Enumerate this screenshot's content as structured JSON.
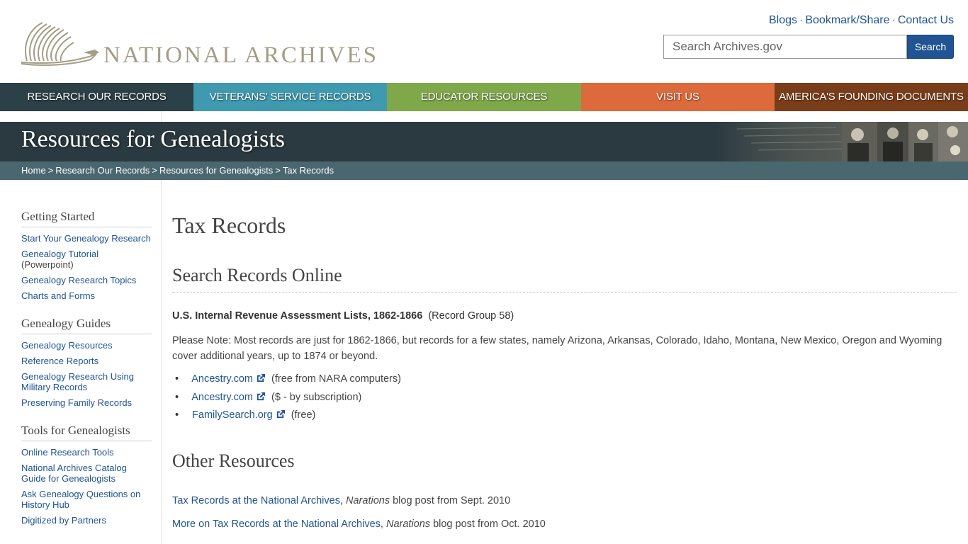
{
  "header": {
    "logo_text": "NATIONAL ARCHIVES",
    "utility_links": [
      "Blogs",
      "Bookmark/Share",
      "Contact Us"
    ],
    "search_placeholder": "Search Archives.gov",
    "search_button": "Search"
  },
  "nav": {
    "items": [
      "RESEARCH OUR RECORDS",
      "VETERANS' SERVICE RECORDS",
      "EDUCATOR RESOURCES",
      "VISIT US",
      "AMERICA'S FOUNDING DOCUMENTS"
    ]
  },
  "banner": {
    "title": "Resources for Genealogists"
  },
  "breadcrumb": [
    "Home",
    "Research Our Records",
    "Resources for Genealogists",
    "Tax Records"
  ],
  "sidebar": {
    "groups": [
      {
        "heading": "Getting Started",
        "links": [
          "Start Your Genealogy Research",
          "Genealogy Tutorial",
          "Genealogy Research Topics",
          "Charts and Forms"
        ],
        "tutorial_note": "(Powerpoint)"
      },
      {
        "heading": "Genealogy Guides",
        "links": [
          "Genealogy Resources",
          "Reference Reports",
          "Genealogy Research Using Military Records",
          "Preserving Family Records"
        ]
      },
      {
        "heading": "Tools for Genealogists",
        "links": [
          "Online Research Tools",
          "National Archives Catalog Guide for Genealogists",
          "Ask Genealogy Questions on History Hub",
          "Digitized by Partners"
        ]
      }
    ]
  },
  "main": {
    "page_title": "Tax Records",
    "section1_title": "Search Records Online",
    "record_title": "U.S. Internal Revenue Assessment Lists, 1862-1866",
    "record_group": "(Record Group 58)",
    "note": "Please Note:  Most records are just for 1862-1866, but records for a few states, namely Arizona, Arkansas, Colorado, Idaho, Montana, New Mexico, Oregon and Wyoming cover additional years, up to 1874 or beyond.",
    "online_links": [
      {
        "label": "Ancestry.com",
        "note": "(free from NARA computers)"
      },
      {
        "label": "Ancestry.com",
        "note": "($ - by subscription)"
      },
      {
        "label": "FamilySearch.org",
        "note": "(free)"
      }
    ],
    "section2_title": "Other Resources",
    "resources": [
      {
        "link": "Tax Records at the National Archives",
        "comma": ",",
        "italic": "Narations",
        "rest": " blog post from Sept. 2010"
      },
      {
        "link": "More on Tax Records at the National Archives",
        "comma": ",",
        "italic": "Narations",
        "rest": " blog post from Oct. 2010"
      }
    ]
  }
}
